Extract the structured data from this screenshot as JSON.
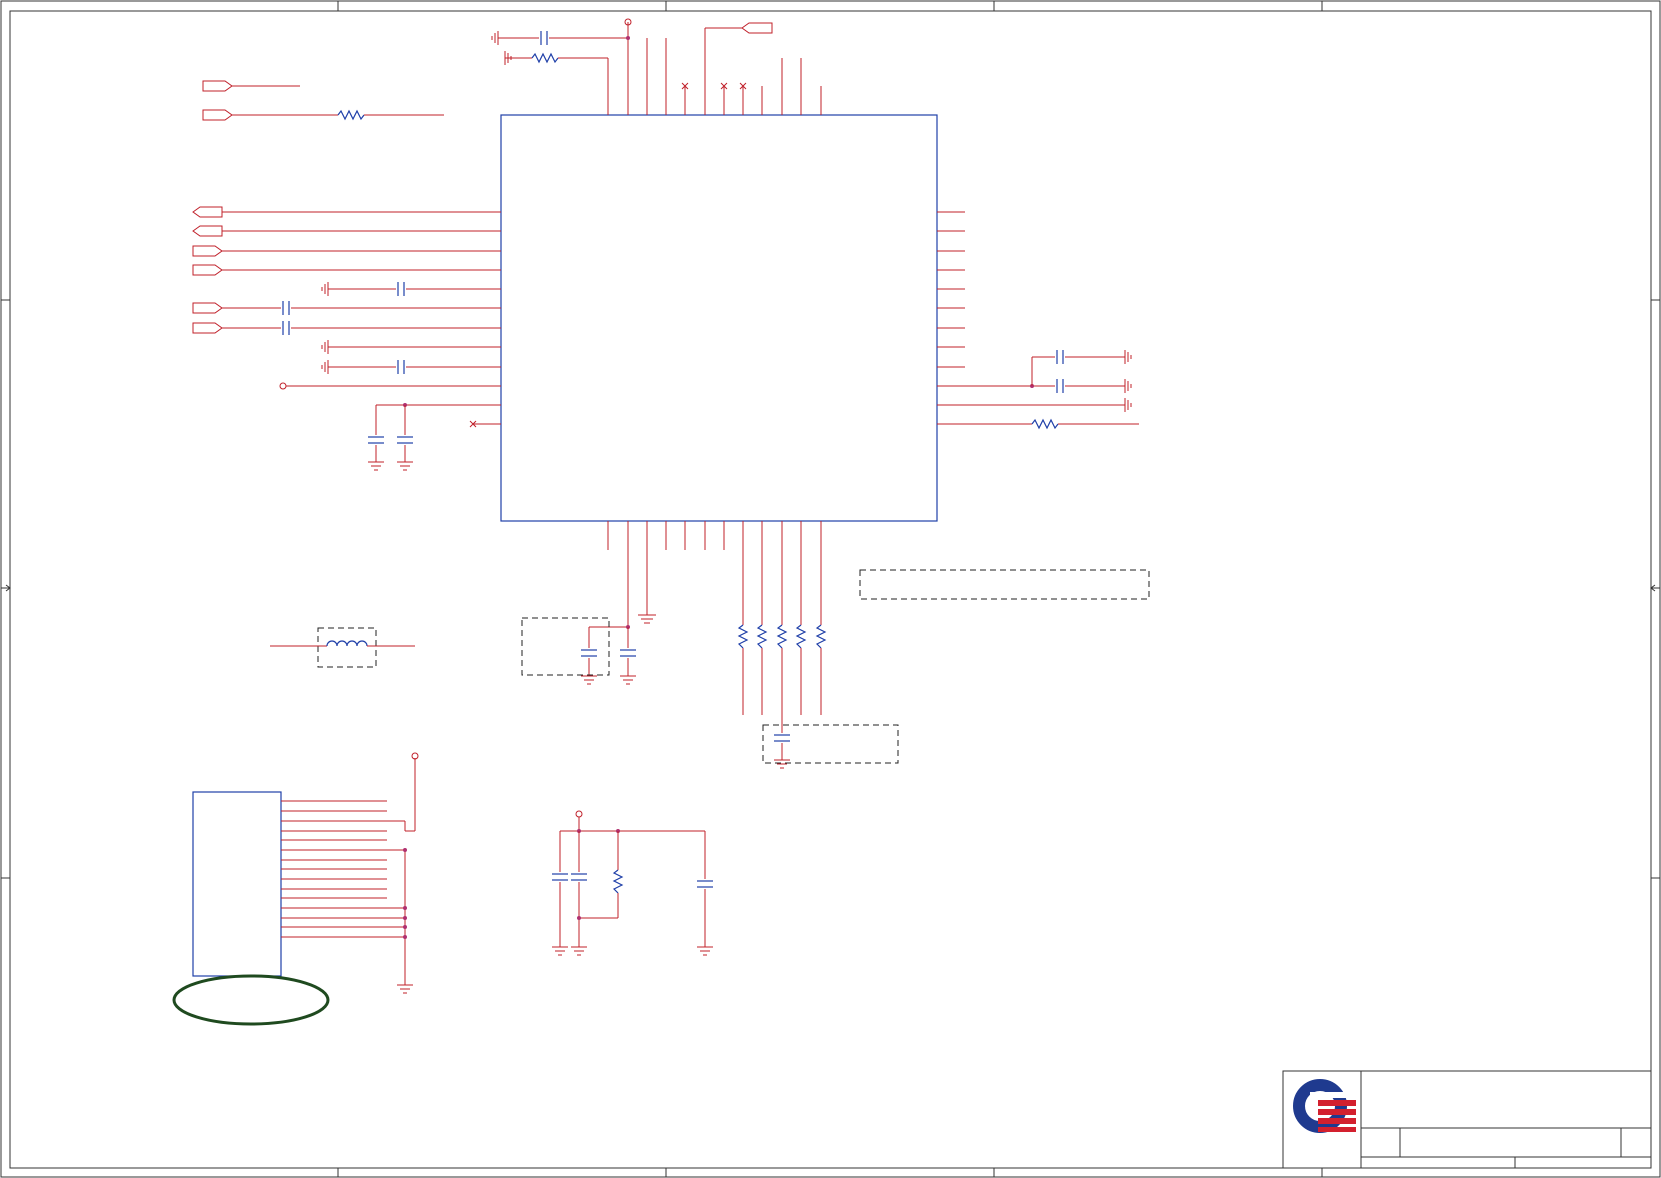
{
  "page": {
    "title": ""
  },
  "colors": {
    "wire": "#c0202a",
    "component": "#1f3fa8",
    "junction": "#b03070",
    "frame": "#333333",
    "logo_blue": "#1f3a8f",
    "logo_red": "#d3202e",
    "ellipse": "#1f4a1f"
  },
  "icons": {
    "logo": "q-company-logo-icon",
    "ground": "ground-icon",
    "power_pin": "power-rail-icon",
    "port": "net-port-icon"
  },
  "title_block": {
    "title": "",
    "sheet": "",
    "rev": ""
  }
}
